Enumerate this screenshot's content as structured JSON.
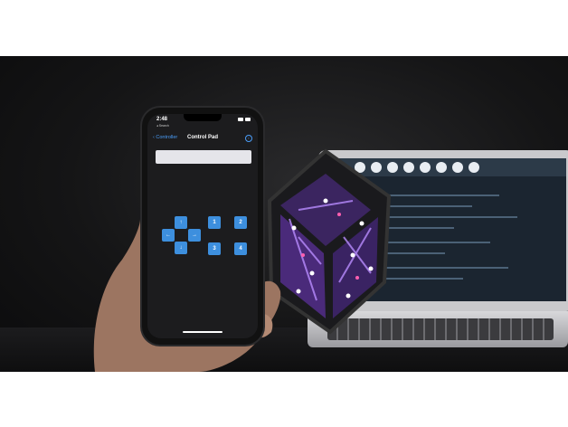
{
  "status_bar": {
    "time": "2:48",
    "back_app": "◂ Search"
  },
  "nav": {
    "back_label": "Controller",
    "title": "Control Pad",
    "info_icon": "info-icon"
  },
  "text_field": {
    "value": ""
  },
  "dpad": {
    "up": "up-arrow-icon",
    "left": "left-arrow-icon",
    "right": "right-arrow-icon",
    "down": "down-arrow-icon"
  },
  "buttons": {
    "b1": "1",
    "b2": "2",
    "b3": "3",
    "b4": "4"
  },
  "colors": {
    "accent": "#3d8fde",
    "cube_glow": "#9b6cff",
    "screen_bg": "#1c1c1e"
  }
}
